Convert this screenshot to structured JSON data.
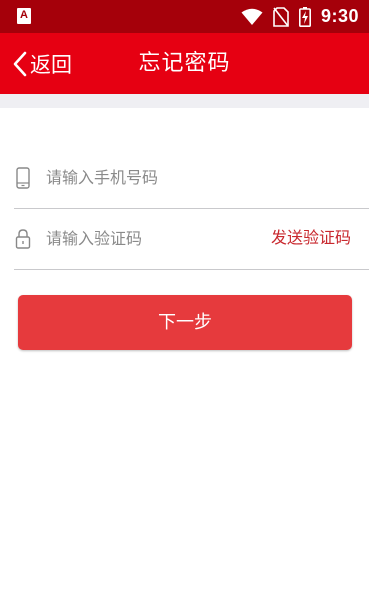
{
  "status_bar": {
    "app_icon_letter": "A",
    "time": "9:30",
    "icons": [
      "wifi-icon",
      "no-sim-icon",
      "battery-charging-icon"
    ]
  },
  "header": {
    "back_label": "返回",
    "title": "忘记密码"
  },
  "form": {
    "phone": {
      "placeholder": "请输入手机号码",
      "value": "",
      "icon": "phone-icon"
    },
    "code": {
      "placeholder": "请输入验证码",
      "value": "",
      "icon": "lock-icon",
      "send_label": "发送验证码"
    },
    "next_label": "下一步"
  },
  "colors": {
    "status_bar": "#a5000a",
    "app_bar": "#e60012",
    "button": "#e63a3d",
    "link": "#c8282e"
  }
}
